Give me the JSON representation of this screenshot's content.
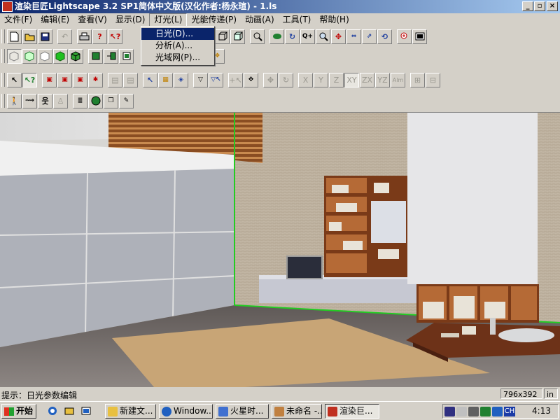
{
  "window": {
    "title": "渲染巨匠Lightscape 3.2 SP1简体中文版(汉化作者:杨永瑄) - 1.ls"
  },
  "menubar": [
    "文件(F)",
    "编辑(E)",
    "查看(V)",
    "显示(D)",
    "灯光(L)",
    "光能传递(P)",
    "动画(A)",
    "工具(T)",
    "帮助(H)"
  ],
  "light_menu": [
    "日光(D)...",
    "分析(A)...",
    "光域网(P)..."
  ],
  "axis_buttons": [
    "X",
    "Y",
    "Z",
    "XY",
    "ZX",
    "YZ",
    "Alm"
  ],
  "status": {
    "text": "提示：日光参数编辑",
    "size": "796x392",
    "mode": "in"
  },
  "taskbar": {
    "start": "开始",
    "tasks": [
      "新建文...",
      "Window...",
      "火星时...",
      "未命名 -...",
      "渲染巨..."
    ],
    "tray_lang": "CH",
    "clock": "4:13"
  },
  "colors": {
    "titlebar": "#0a246a",
    "menu_highlight": "#0a246a",
    "guide_line": "#22cc22"
  }
}
